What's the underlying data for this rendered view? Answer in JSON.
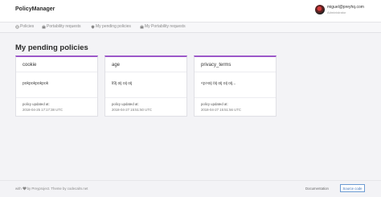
{
  "header": {
    "brand": "PolicyManager",
    "user": {
      "email": "miguel@preyhq.com",
      "role": "Administrator"
    }
  },
  "nav": {
    "items": [
      {
        "label": "Policies",
        "icon": "globe-icon"
      },
      {
        "label": "Portability requests",
        "icon": "briefcase-icon"
      },
      {
        "label": "My pending policies",
        "icon": "shield-icon"
      },
      {
        "label": "My Portability requests",
        "icon": "briefcase-icon"
      }
    ]
  },
  "main": {
    "title": "My pending policies",
    "cards": [
      {
        "title": "cookie",
        "content": "pokpokpokpok",
        "updated_label": "policy updated at:",
        "updated_at": "2018-04-25 17:17:38 UTC"
      },
      {
        "title": "age",
        "content": "li9j oij oij oij",
        "updated_label": "policy updated at:",
        "updated_at": "2018-04-27 15:51:50 UTC"
      },
      {
        "title": "privacy_terms",
        "content": "<p>oij öij oij oij oij...",
        "updated_label": "policy updated at:",
        "updated_at": "2018-04-27 15:51:56 UTC"
      }
    ]
  },
  "footer": {
    "with": "with",
    "by": "by Preyproject. Theme by codecalm.net",
    "documentation": "Documentation",
    "source_code": "Source code"
  },
  "colors": {
    "accent": "#9c58c9",
    "link_blue": "#3f73b8"
  }
}
